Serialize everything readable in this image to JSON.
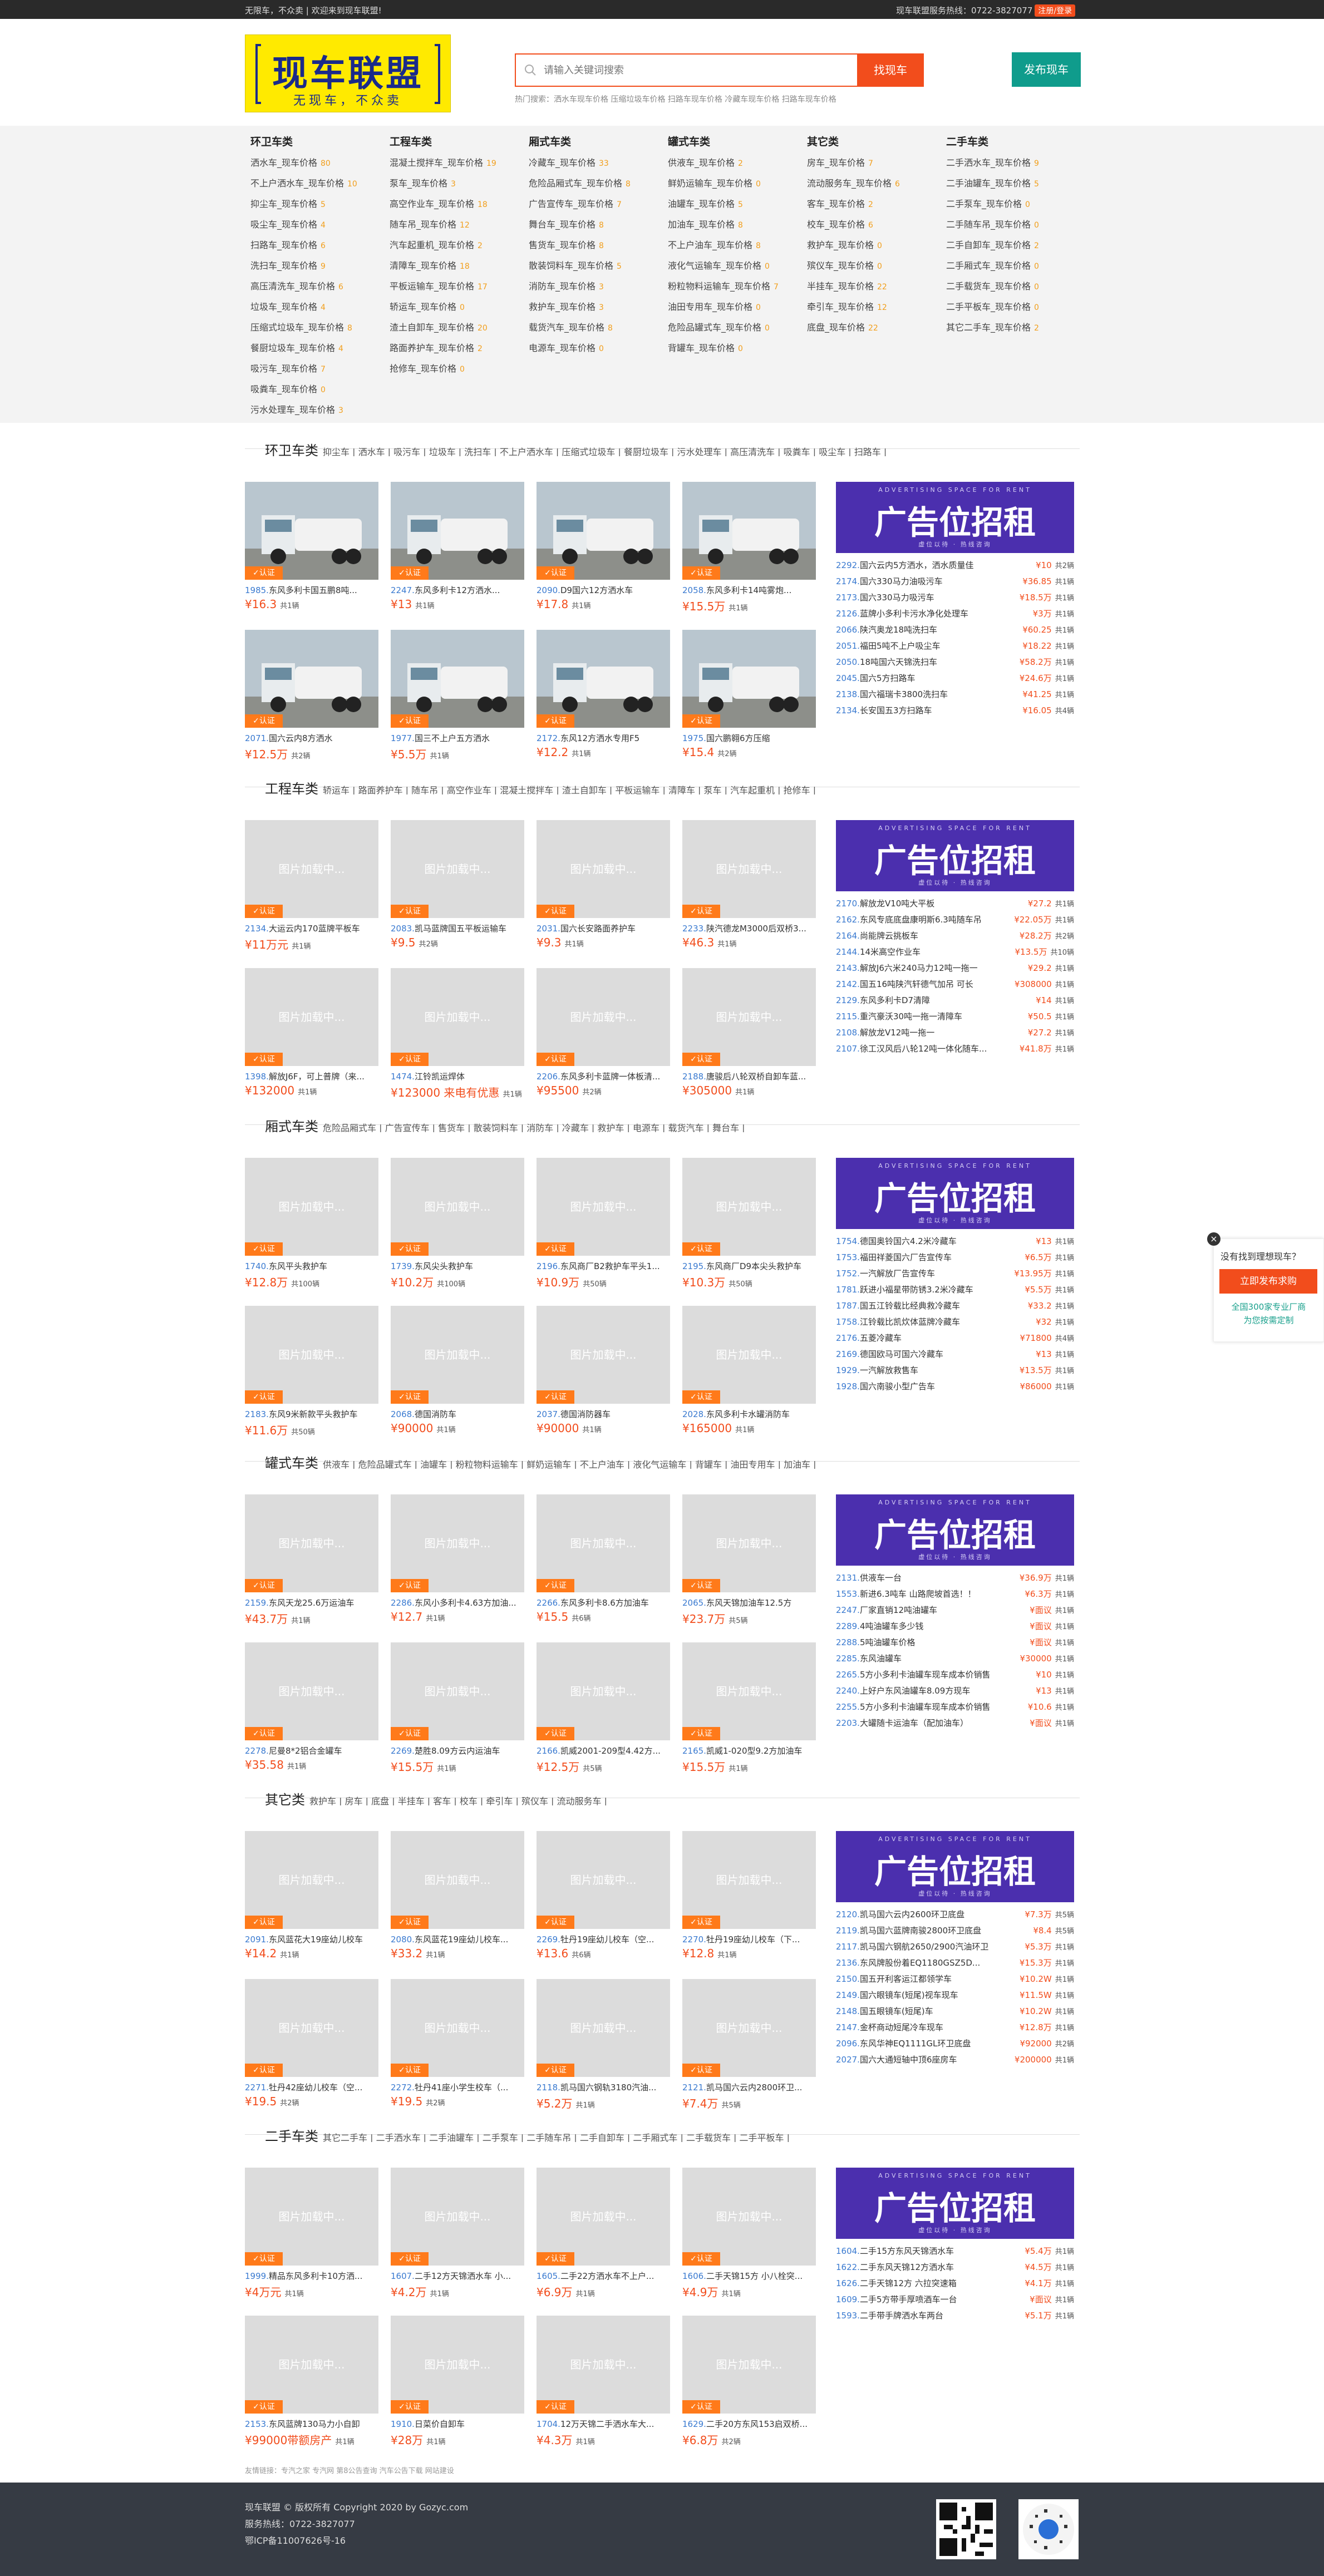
{
  "topbar": {
    "welcome": "无限车，不众卖 | 欢迎来到现车联盟!",
    "hotline": "现车联盟服务热线：0722-3827077",
    "register": "注册/登录"
  },
  "logo": {
    "title": "现车联盟",
    "slogan": "无现车，不众卖"
  },
  "search": {
    "placeholder": "请输入关键词搜索",
    "button": "找现车",
    "buy_button": "发布现车",
    "hot": "热门搜索：洒水车现车价格 压缩垃圾车价格 扫路车现车价格 冷藏车现车价格 扫路车现车价格"
  },
  "nav_cats": [
    {
      "title": "环卫车类",
      "items": [
        [
          "洒水车_现车价格",
          "80"
        ],
        [
          "不上户洒水车_现车价格",
          "10"
        ],
        [
          "抑尘车_现车价格",
          "5"
        ],
        [
          "吸尘车_现车价格",
          "4"
        ],
        [
          "扫路车_现车价格",
          "6"
        ],
        [
          "洗扫车_现车价格",
          "9"
        ],
        [
          "高压清洗车_现车价格",
          "6"
        ],
        [
          "垃圾车_现车价格",
          "4"
        ],
        [
          "压缩式垃圾车_现车价格",
          "8"
        ],
        [
          "餐厨垃圾车_现车价格",
          "4"
        ],
        [
          "吸污车_现车价格",
          "7"
        ],
        [
          "吸粪车_现车价格",
          "0"
        ],
        [
          "污水处理车_现车价格",
          "3"
        ]
      ]
    },
    {
      "title": "工程车类",
      "items": [
        [
          "混凝土搅拌车_现车价格",
          "19"
        ],
        [
          "泵车_现车价格",
          "3"
        ],
        [
          "高空作业车_现车价格",
          "18"
        ],
        [
          "随车吊_现车价格",
          "12"
        ],
        [
          "汽车起重机_现车价格",
          "2"
        ],
        [
          "清障车_现车价格",
          "18"
        ],
        [
          "平板运输车_现车价格",
          "17"
        ],
        [
          "轿运车_现车价格",
          "0"
        ],
        [
          "渣土自卸车_现车价格",
          "20"
        ],
        [
          "路面养护车_现车价格",
          "2"
        ],
        [
          "抢修车_现车价格",
          "0"
        ]
      ]
    },
    {
      "title": "厢式车类",
      "items": [
        [
          "冷藏车_现车价格",
          "33"
        ],
        [
          "危险品厢式车_现车价格",
          "8"
        ],
        [
          "广告宣传车_现车价格",
          "7"
        ],
        [
          "舞台车_现车价格",
          "8"
        ],
        [
          "售货车_现车价格",
          "8"
        ],
        [
          "散装饲料车_现车价格",
          "5"
        ],
        [
          "消防车_现车价格",
          "3"
        ],
        [
          "救护车_现车价格",
          "3"
        ],
        [
          "载货汽车_现车价格",
          "8"
        ],
        [
          "电源车_现车价格",
          "0"
        ]
      ]
    },
    {
      "title": "罐式车类",
      "items": [
        [
          "供液车_现车价格",
          "2"
        ],
        [
          "鲜奶运输车_现车价格",
          "0"
        ],
        [
          "油罐车_现车价格",
          "5"
        ],
        [
          "加油车_现车价格",
          "8"
        ],
        [
          "不上户油车_现车价格",
          "8"
        ],
        [
          "液化气运输车_现车价格",
          "0"
        ],
        [
          "粉粒物料运输车_现车价格",
          "7"
        ],
        [
          "油田专用车_现车价格",
          "0"
        ],
        [
          "危险品罐式车_现车价格",
          "0"
        ],
        [
          "背罐车_现车价格",
          "0"
        ]
      ]
    },
    {
      "title": "其它类",
      "items": [
        [
          "房车_现车价格",
          "7"
        ],
        [
          "流动服务车_现车价格",
          "6"
        ],
        [
          "客车_现车价格",
          "2"
        ],
        [
          "校车_现车价格",
          "6"
        ],
        [
          "救护车_现车价格",
          "0"
        ],
        [
          "殡仪车_现车价格",
          "0"
        ],
        [
          "半挂车_现车价格",
          "22"
        ],
        [
          "牵引车_现车价格",
          "12"
        ],
        [
          "底盘_现车价格",
          "22"
        ]
      ]
    },
    {
      "title": "二手车类",
      "items": [
        [
          "二手洒水车_现车价格",
          "9"
        ],
        [
          "二手油罐车_现车价格",
          "5"
        ],
        [
          "二手泵车_现车价格",
          "0"
        ],
        [
          "二手随车吊_现车价格",
          "0"
        ],
        [
          "二手自卸车_现车价格",
          "2"
        ],
        [
          "二手厢式车_现车价格",
          "0"
        ],
        [
          "二手载货车_现车价格",
          "0"
        ],
        [
          "二手平板车_现车价格",
          "0"
        ],
        [
          "其它二手车_现车价格",
          "2"
        ]
      ]
    }
  ],
  "sections": [
    {
      "title": "环卫车类",
      "tags": "抑尘车 | 洒水车 | 吸污车 | 垃圾车 | 洗扫车 | 不上户洒水车 | 压缩式垃圾车 | 餐厨垃圾车 | 污水处理车 | 高压清洗车 | 吸粪车 | 吸尘车 | 扫路车 |",
      "cards": [
        [
          "1985.",
          "东风多利卡国五鹏8吨...",
          "¥16.3",
          "共1辆"
        ],
        [
          "2247.",
          "东风多利卡12方洒水...",
          "¥13",
          "共1辆"
        ],
        [
          "2090.",
          "D9国六12方洒水车",
          "¥17.8",
          "共1辆"
        ],
        [
          "2058.",
          "东风多利卡14吨雾炮...",
          "¥15.5万",
          "共1辆"
        ],
        [
          "2071.",
          "国六云内8方洒水",
          "¥12.5万",
          "共2辆"
        ],
        [
          "1977.",
          "国三不上户五方洒水",
          "¥5.5万",
          "共1辆"
        ],
        [
          "2172.",
          "东风12方洒水专用F5",
          "¥12.2",
          "共1辆"
        ],
        [
          "1975.",
          "国六鹏翱6方压缩",
          "¥15.4",
          "共2辆"
        ]
      ],
      "list": [
        [
          "2292.",
          "国六云内5方洒水，洒水质量佳",
          "¥10",
          "共2辆"
        ],
        [
          "2174.",
          "国六330马力油吸污车",
          "¥36.85",
          "共1辆"
        ],
        [
          "2173.",
          "国六330马力吸污车",
          "¥18.5万",
          "共1辆"
        ],
        [
          "2126.",
          "蓝牌小多利卡污水净化处理车",
          "¥3万",
          "共1辆"
        ],
        [
          "2066.",
          "陕汽奥龙18吨洗扫车",
          "¥60.25",
          "共1辆"
        ],
        [
          "2051.",
          "福田5吨不上户吸尘车",
          "¥18.22",
          "共1辆"
        ],
        [
          "2050.",
          "18吨国六天锦洗扫车",
          "¥58.2万",
          "共1辆"
        ],
        [
          "2045.",
          "国六5方扫路车",
          "¥24.6万",
          "共1辆"
        ],
        [
          "2138.",
          "国六福瑞卡3800洗扫车",
          "¥41.25",
          "共1辆"
        ],
        [
          "2134.",
          "长安国五3方扫路车",
          "¥16.05",
          "共4辆"
        ]
      ]
    },
    {
      "title": "工程车类",
      "tags": "轿运车 | 路面养护车 | 随车吊 | 高空作业车 | 混凝土搅拌车 | 渣土自卸车 | 平板运输车 | 清障车 | 泵车 | 汽车起重机 | 抢修车 |",
      "cards": [
        [
          "2134.",
          "大运云内170蓝牌平板车",
          "¥11万元",
          "共1辆"
        ],
        [
          "2083.",
          "凯马蓝牌国五平板运输车",
          "¥9.5",
          "共2辆"
        ],
        [
          "2031.",
          "国六长安路面养护车",
          "¥9.3",
          "共1辆"
        ],
        [
          "2233.",
          "陕汽德龙M3000后双桥3...",
          "¥46.3",
          "共1辆"
        ],
        [
          "1398.",
          "解放J6F，可上普牌（来...",
          "¥132000",
          "共1辆"
        ],
        [
          "1474.",
          "江铃凯运焊体",
          "¥123000 来电有优惠",
          "共1辆"
        ],
        [
          "2206.",
          "东风多利卡蓝牌一体板清...",
          "¥95500",
          "共2辆"
        ],
        [
          "2188.",
          "唐骏后八轮双桥自卸车蓝...",
          "¥305000",
          "共1辆"
        ]
      ],
      "list": [
        [
          "2170.",
          "解放龙V10吨大平板",
          "¥27.2",
          "共1辆"
        ],
        [
          "2162.",
          "东风专底底盘康明斯6.3吨随车吊",
          "¥22.05万",
          "共1辆"
        ],
        [
          "2164.",
          "尚能牌云挑板车",
          "¥28.2万",
          "共2辆"
        ],
        [
          "2144.",
          "14米高空作业车",
          "¥13.5万",
          "共10辆"
        ],
        [
          "2143.",
          "解放J6六米240马力12吨一拖一",
          "¥29.2",
          "共1辆"
        ],
        [
          "2142.",
          "国五16吨陕汽轩德气加吊 可长",
          "¥308000",
          "共1辆"
        ],
        [
          "2129.",
          "东风多利卡D7清障",
          "¥14",
          "共1辆"
        ],
        [
          "2115.",
          "重汽豪沃30吨一拖一清障车",
          "¥50.5",
          "共1辆"
        ],
        [
          "2108.",
          "解放龙V12吨一拖一",
          "¥27.2",
          "共1辆"
        ],
        [
          "2107.",
          "徐工汉风后八轮12吨一体化随车...",
          "¥41.8万",
          "共1辆"
        ]
      ]
    },
    {
      "title": "厢式车类",
      "tags": "危险品厢式车 | 广告宣传车 | 售货车 | 散装饲料车 | 消防车 | 冷藏车 | 救护车 | 电源车 | 载货汽车 | 舞台车 |",
      "cards": [
        [
          "1740.",
          "东风平头救护车",
          "¥12.8万",
          "共100辆"
        ],
        [
          "1739.",
          "东风尖头救护车",
          "¥10.2万",
          "共100辆"
        ],
        [
          "2196.",
          "东风商厂B2救护车平头1...",
          "¥10.9万",
          "共50辆"
        ],
        [
          "2195.",
          "东风商厂D9本尖头救护车",
          "¥10.3万",
          "共50辆"
        ],
        [
          "2183.",
          "东风9米新款平头救护车",
          "¥11.6万",
          "共50辆"
        ],
        [
          "2068.",
          "德国消防车",
          "¥90000",
          "共1辆"
        ],
        [
          "2037.",
          "德国消防器车",
          "¥90000",
          "共1辆"
        ],
        [
          "2028.",
          "东风多利卡水罐消防车",
          "¥165000",
          "共1辆"
        ]
      ],
      "list": [
        [
          "1754.",
          "德国奥铃国六4.2米冷藏车",
          "¥13",
          "共1辆"
        ],
        [
          "1753.",
          "福田祥菱国六厂告宣传车",
          "¥6.5万",
          "共1辆"
        ],
        [
          "1752.",
          "一汽解放厂告宣传车",
          "¥13.95万",
          "共1辆"
        ],
        [
          "1781.",
          "跃进小福星带防锈3.2米冷藏车",
          "¥5.5万",
          "共1辆"
        ],
        [
          "1787.",
          "国五江铃载比经典救冷藏车",
          "¥33.2",
          "共1辆"
        ],
        [
          "1758.",
          "江铃载比凯炊体蓝牌冷藏车",
          "¥32",
          "共1辆"
        ],
        [
          "2176.",
          "五菱冷藏车",
          "¥71800",
          "共4辆"
        ],
        [
          "2169.",
          "德国欧马可国六冷藏车",
          "¥13",
          "共1辆"
        ],
        [
          "1929.",
          "一汽解放救售车",
          "¥13.5万",
          "共1辆"
        ],
        [
          "1928.",
          "国六南骏小型广告车",
          "¥86000",
          "共1辆"
        ]
      ]
    },
    {
      "title": "罐式车类",
      "tags": "供液车 | 危险品罐式车 | 油罐车 | 粉粒物料运输车 | 鲜奶运输车 | 不上户油车 | 液化气运输车 | 背罐车 | 油田专用车 | 加油车 |",
      "cards": [
        [
          "2159.",
          "东风天龙25.6万运油车",
          "¥43.7万",
          "共1辆"
        ],
        [
          "2286.",
          "东风小多利卡4.63方加油...",
          "¥12.7",
          "共1辆"
        ],
        [
          "2266.",
          "东风多利卡8.6方加油车",
          "¥15.5",
          "共6辆"
        ],
        [
          "2065.",
          "东风天锦加油车12.5方",
          "¥23.7万",
          "共5辆"
        ],
        [
          "2278.",
          "尼曼8*2铝合金罐车",
          "¥35.58",
          "共1辆"
        ],
        [
          "2269.",
          "楚胜8.09方云内运油车",
          "¥15.5万",
          "共1辆"
        ],
        [
          "2166.",
          "凯威2001-209型4.42方...",
          "¥12.5万",
          "共5辆"
        ],
        [
          "2165.",
          "凯威1-020型9.2方加油车",
          "¥15.5万",
          "共1辆"
        ]
      ],
      "list": [
        [
          "2131.",
          "供液车一台",
          "¥36.9万",
          "共1辆"
        ],
        [
          "1553.",
          "新进6.3吨车 山路爬坡首选！！",
          "¥6.3万",
          "共1辆"
        ],
        [
          "2247.",
          "厂家直销12吨油罐车",
          "¥面议",
          "共1辆"
        ],
        [
          "2289.",
          "4吨油罐车多少钱",
          "¥面议",
          "共1辆"
        ],
        [
          "2288.",
          "5吨油罐车价格",
          "¥面议",
          "共1辆"
        ],
        [
          "2285.",
          "东风油罐车",
          "¥30000",
          "共1辆"
        ],
        [
          "2265.",
          "5方小多利卡油罐车现车成本价销售",
          "¥10",
          "共1辆"
        ],
        [
          "2240.",
          "上好户东风油罐车8.09方现车",
          "¥13",
          "共1辆"
        ],
        [
          "2255.",
          "5方小多利卡油罐车现车成本价销售",
          "¥10.6",
          "共1辆"
        ],
        [
          "2203.",
          "大罐随卡运油车（配加油车）",
          "¥面议",
          "共1辆"
        ]
      ]
    },
    {
      "title": "其它类",
      "tags": "救护车 | 房车 | 底盘 | 半挂车 | 客车 | 校车 | 牵引车 | 殡仪车 | 流动服务车 |",
      "cards": [
        [
          "2091.",
          "东风蓝花大19座幼儿校车",
          "¥14.2",
          "共1辆"
        ],
        [
          "2080.",
          "东风蓝花19座幼儿校车...",
          "¥33.2",
          "共1辆"
        ],
        [
          "2269.",
          "牡丹19座幼儿校车（空...",
          "¥13.6",
          "共6辆"
        ],
        [
          "2270.",
          "牡丹19座幼儿校车（下...",
          "¥12.8",
          "共1辆"
        ],
        [
          "2271.",
          "牡丹42座幼儿校车（空...",
          "¥19.5",
          "共2辆"
        ],
        [
          "2272.",
          "牡丹41座小学生校车（...",
          "¥19.5",
          "共2辆"
        ],
        [
          "2118.",
          "凯马国六钢轨3180汽油...",
          "¥5.2万",
          "共1辆"
        ],
        [
          "2121.",
          "凯马国六云内2800环卫...",
          "¥7.4万",
          "共5辆"
        ]
      ],
      "list": [
        [
          "2120.",
          "凯马国六云内2600环卫底盘",
          "¥7.3万",
          "共5辆"
        ],
        [
          "2119.",
          "凯马国六蓝牌南骏2800环卫底盘",
          "¥8.4",
          "共5辆"
        ],
        [
          "2117.",
          "凯马国六钢航2650/2900汽油环卫",
          "¥5.3万",
          "共1辆"
        ],
        [
          "2136.",
          "东风牌股份着EQ1180GSZ5D...",
          "¥15.3万",
          "共1辆"
        ],
        [
          "2150.",
          "国五开利客运江都领学车",
          "¥10.2W",
          "共1辆"
        ],
        [
          "2149.",
          "国六眼镜车(短尾)视车现车",
          "¥11.5W",
          "共1辆"
        ],
        [
          "2148.",
          "国五眼镜车(短尾)车",
          "¥10.2W",
          "共1辆"
        ],
        [
          "2147.",
          "金杯商动短尾冷车现车",
          "¥12.8万",
          "共1辆"
        ],
        [
          "2096.",
          "东风华神EQ1111GL环卫底盘",
          "¥92000",
          "共2辆"
        ],
        [
          "2027.",
          "国六大通短轴中顶6座房车",
          "¥200000",
          "共1辆"
        ]
      ]
    },
    {
      "title": "二手车类",
      "tags": "其它二手车 | 二手洒水车 | 二手油罐车 | 二手泵车 | 二手随车吊 | 二手自卸车 | 二手厢式车 | 二手载货车 | 二手平板车 |",
      "cards": [
        [
          "1999.",
          "精品东风多利卡10方洒...",
          "¥4万元",
          "共1辆"
        ],
        [
          "1607.",
          "二手12方天锦洒水车 小...",
          "¥4.2万",
          "共1辆"
        ],
        [
          "1605.",
          "二手22方洒水车不上户...",
          "¥6.9万",
          "共1辆"
        ],
        [
          "1606.",
          "二手天锦15方 小八栓突...",
          "¥4.9万",
          "共1辆"
        ],
        [
          "2153.",
          "东风蓝牌130马力小自卸",
          "¥99000带额房产",
          "共1辆"
        ],
        [
          "1910.",
          "日菜价自卸车",
          "¥28万",
          "共1辆"
        ],
        [
          "1704.",
          "12万天锦二手洒水车大...",
          "¥4.3万",
          "共1辆"
        ],
        [
          "1629.",
          "二手20方东风153启双桥...",
          "¥6.8万",
          "共2辆"
        ]
      ],
      "list": [
        [
          "1604.",
          "二手15方东风天锦洒水车",
          "¥5.4万",
          "共1辆"
        ],
        [
          "1622.",
          "二手东风天锦12方洒水车",
          "¥4.5万",
          "共1辆"
        ],
        [
          "1626.",
          "二手天锦12方 六拉突速箱",
          "¥4.1万",
          "共1辆"
        ],
        [
          "1609.",
          "二手5方带手厚喷酒车一台",
          "¥面议",
          "共1辆"
        ],
        [
          "1593.",
          "二手带手牌洒水车两台",
          "¥5.1万",
          "共1辆"
        ]
      ]
    }
  ],
  "card_ui": {
    "placeholder": "图片加载中...",
    "badge": "✓认证"
  },
  "ad": {
    "top": "ADVERTISING SPACE FOR RENT",
    "big": "广告位招租",
    "sub": "虚位以待 · 热线咨询"
  },
  "float": {
    "q": "没有找到理想现车？",
    "btn": "立即发布求购",
    "g1": "全国300家专业厂商",
    "g2": "为您按需定制",
    "close": "×"
  },
  "friend": "友情链接：专汽之家 专汽网 第8公告查询 汽车公告下载 网站建设",
  "footer": {
    "l1": "现车联盟 © 版权所有 Copyright 2020 by Gozyc.com",
    "l2": "服务热线：0722-3827077",
    "l3": "鄂ICP备11007626号-16"
  }
}
